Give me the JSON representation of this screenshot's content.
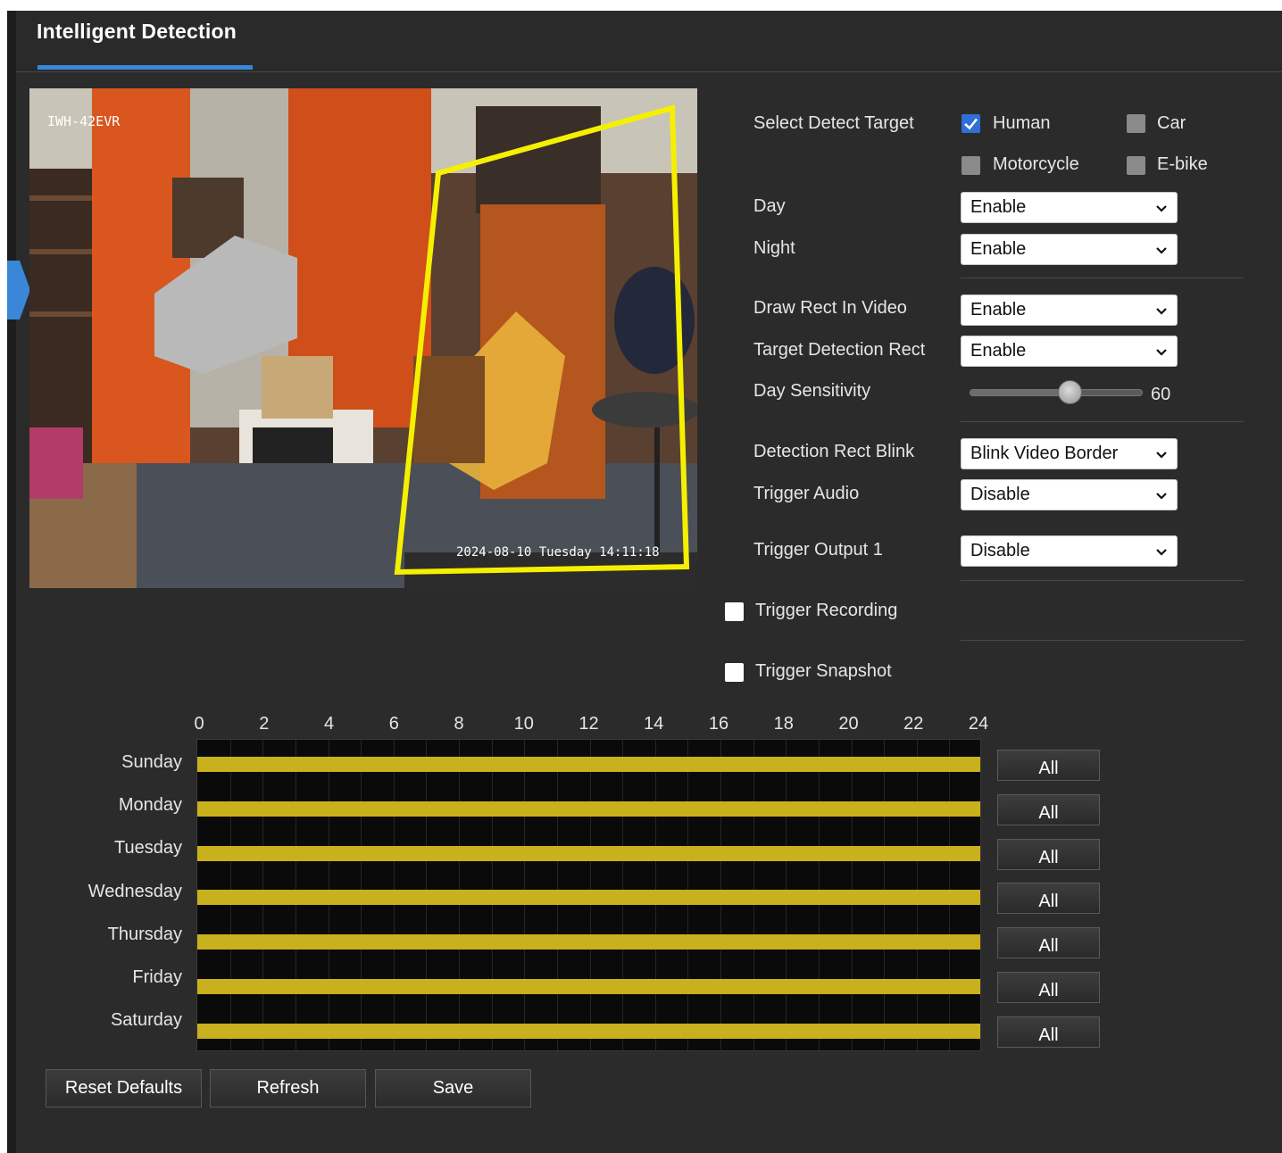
{
  "header": {
    "title": "Intelligent Detection"
  },
  "video": {
    "overlay_label": "IWH-42EVR",
    "overlay_timestamp": "2024-08-10 Tuesday 14:11:18"
  },
  "detect_target": {
    "label": "Select Detect Target",
    "options": [
      {
        "label": "Human",
        "checked": true
      },
      {
        "label": "Car",
        "checked": false
      },
      {
        "label": "Motorcycle",
        "checked": false
      },
      {
        "label": "E-bike",
        "checked": false
      }
    ]
  },
  "settings": {
    "day": {
      "label": "Day",
      "value": "Enable"
    },
    "night": {
      "label": "Night",
      "value": "Enable"
    },
    "draw_rect": {
      "label": "Draw Rect In Video",
      "value": "Enable"
    },
    "target_rect": {
      "label": "Target Detection Rect",
      "value": "Enable"
    },
    "day_sensitivity": {
      "label": "Day Sensitivity",
      "value": "60"
    },
    "rect_blink": {
      "label": "Detection Rect Blink",
      "value": "Blink Video Border"
    },
    "trigger_audio": {
      "label": "Trigger Audio",
      "value": "Disable"
    },
    "trigger_output": {
      "label": "Trigger Output 1",
      "value": "Disable"
    },
    "trigger_recording": {
      "label": "Trigger Recording",
      "checked": false
    },
    "trigger_snapshot": {
      "label": "Trigger Snapshot",
      "checked": false
    }
  },
  "schedule": {
    "hours": [
      "0",
      "2",
      "4",
      "6",
      "8",
      "10",
      "12",
      "14",
      "16",
      "18",
      "20",
      "22",
      "24"
    ],
    "days": [
      "Sunday",
      "Monday",
      "Tuesday",
      "Wednesday",
      "Thursday",
      "Friday",
      "Saturday"
    ],
    "all_label": "All",
    "bar_color": "#c8b11c"
  },
  "buttons": {
    "reset": "Reset Defaults",
    "refresh": "Refresh",
    "save": "Save"
  },
  "colors": {
    "accent": "#3a86d8",
    "detection_box": "#f5f000",
    "checkbox_on": "#2f6fd6"
  }
}
